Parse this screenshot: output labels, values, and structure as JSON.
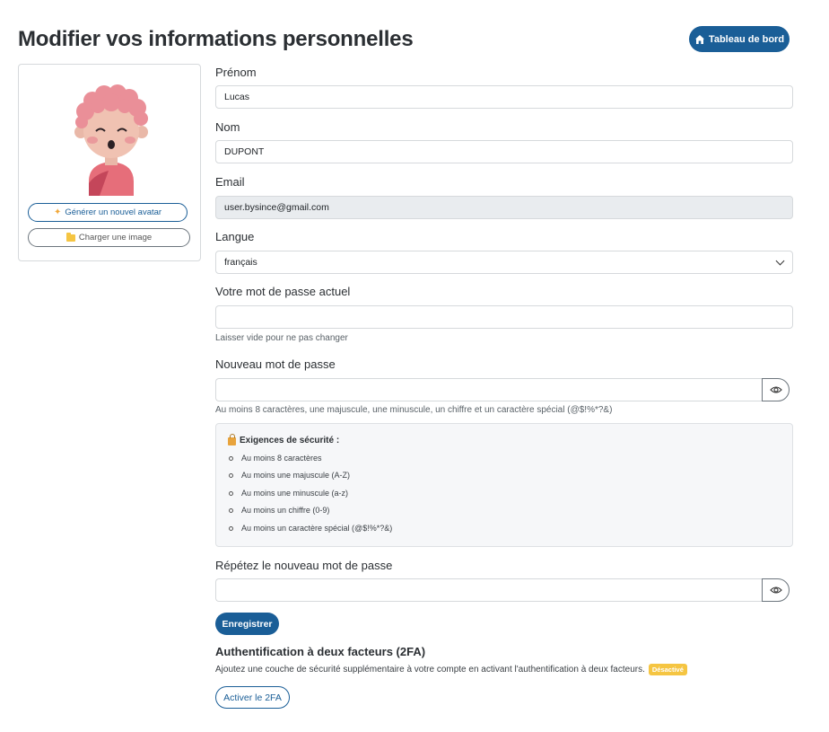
{
  "header": {
    "title": "Modifier vos informations personnelles",
    "dashboard_label": "Tableau de bord"
  },
  "avatar": {
    "generate_label": "Générer un nouvel avatar",
    "upload_label": "Charger une image"
  },
  "form": {
    "firstname": {
      "label": "Prénom",
      "value": "Lucas"
    },
    "lastname": {
      "label": "Nom",
      "value": "DUPONT"
    },
    "email": {
      "label": "Email",
      "value": "user.bysince@gmail.com"
    },
    "language": {
      "label": "Langue",
      "value": "français"
    },
    "current_password": {
      "label": "Votre mot de passe actuel",
      "help": "Laisser vide pour ne pas changer"
    },
    "new_password": {
      "label": "Nouveau mot de passe",
      "help": "Au moins 8 caractères, une majuscule, une minuscule, un chiffre et un caractère spécial (@$!%*?&)"
    },
    "requirements": {
      "title": "Exigences de sécurité :",
      "items": [
        "Au moins 8 caractères",
        "Au moins une majuscule (A-Z)",
        "Au moins une minuscule (a-z)",
        "Au moins un chiffre (0-9)",
        "Au moins un caractère spécial (@$!%*?&)"
      ]
    },
    "repeat_password": {
      "label": "Répétez le nouveau mot de passe"
    },
    "save_label": "Enregistrer"
  },
  "twofa": {
    "title": "Authentification à deux facteurs (2FA)",
    "description": "Ajoutez une couche de sécurité supplémentaire à votre compte en activant l'authentification à deux facteurs.",
    "status": "Désactivé",
    "button_label": "Activer le 2FA"
  },
  "colors": {
    "primary": "#1a5e97",
    "badge": "#f5c542"
  },
  "icons": {
    "dashboard": "home-icon",
    "generate": "sparkle-icon",
    "upload": "folder-icon",
    "security": "lock-icon",
    "toggle_visibility": "eye-icon"
  }
}
